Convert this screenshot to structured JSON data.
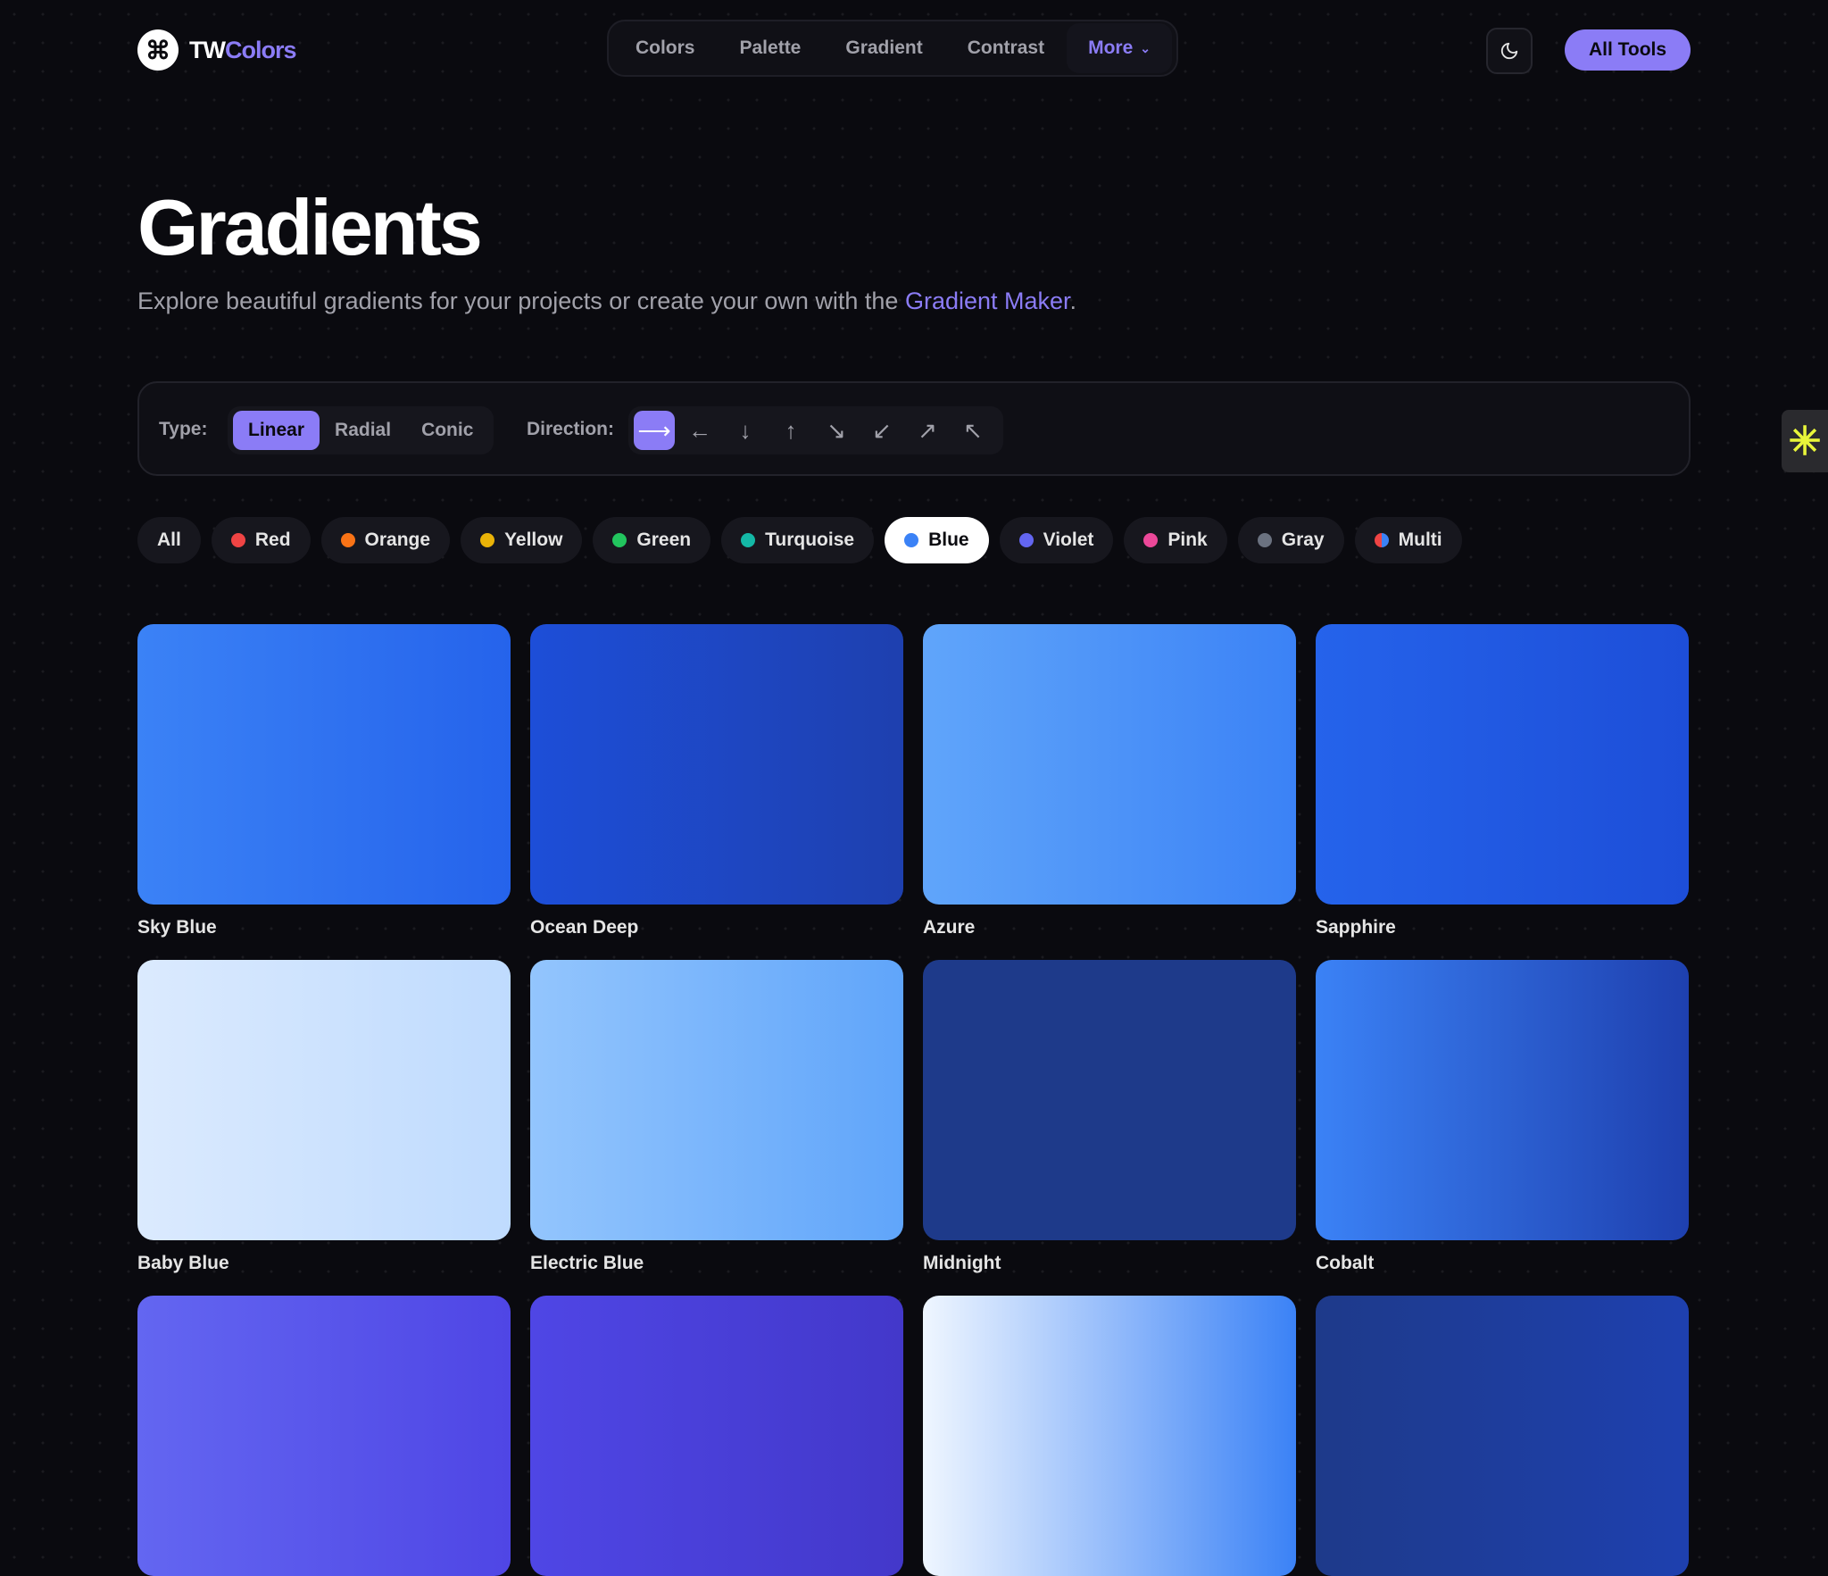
{
  "brand": {
    "logo_glyph": "⌘",
    "name_a": "TW",
    "name_b": "Colors"
  },
  "nav": {
    "items": [
      "Colors",
      "Palette",
      "Gradient",
      "Contrast"
    ],
    "more_label": "More",
    "chevron_glyph": "⌄"
  },
  "header": {
    "all_tools_label": "All Tools",
    "theme_icon": "moon-icon"
  },
  "page": {
    "title": "Gradients",
    "subtitle_before": "Explore beautiful gradients for your projects or create your own with the ",
    "subtitle_link": "Gradient Maker",
    "subtitle_after": "."
  },
  "controls": {
    "type_label": "Type:",
    "types": [
      "Linear",
      "Radial",
      "Conic"
    ],
    "active_type": "Linear",
    "direction_label": "Direction:",
    "directions": [
      {
        "glyph": "⟶",
        "icon": "arrow-right-icon"
      },
      {
        "glyph": "←",
        "icon": "arrow-left-icon"
      },
      {
        "glyph": "↓",
        "icon": "arrow-down-icon"
      },
      {
        "glyph": "↑",
        "icon": "arrow-up-icon"
      },
      {
        "glyph": "↘",
        "icon": "arrow-down-right-icon"
      },
      {
        "glyph": "↙",
        "icon": "arrow-down-left-icon"
      },
      {
        "glyph": "↗",
        "icon": "arrow-up-right-icon"
      },
      {
        "glyph": "↖",
        "icon": "arrow-up-left-icon"
      }
    ],
    "active_direction": 0
  },
  "filters": [
    {
      "label": "All",
      "color": null
    },
    {
      "label": "Red",
      "color": "#ef4444"
    },
    {
      "label": "Orange",
      "color": "#f97316"
    },
    {
      "label": "Yellow",
      "color": "#eab308"
    },
    {
      "label": "Green",
      "color": "#22c55e"
    },
    {
      "label": "Turquoise",
      "color": "#14b8a6"
    },
    {
      "label": "Blue",
      "color": "#3b82f6"
    },
    {
      "label": "Violet",
      "color": "#6366f1"
    },
    {
      "label": "Pink",
      "color": "#ec4899"
    },
    {
      "label": "Gray",
      "color": "#6b7280"
    },
    {
      "label": "Multi",
      "color": "multi"
    }
  ],
  "active_filter": "Blue",
  "gradients": [
    {
      "name": "Sky Blue",
      "from": "#3b82f6",
      "to": "#2563eb"
    },
    {
      "name": "Ocean Deep",
      "from": "#1d4ed8",
      "to": "#1e40af"
    },
    {
      "name": "Azure",
      "from": "#60a5fa",
      "to": "#3b82f6"
    },
    {
      "name": "Sapphire",
      "from": "#2563eb",
      "to": "#1d4ed8"
    },
    {
      "name": "Baby Blue",
      "from": "#dbeafe",
      "to": "#bfdbfe"
    },
    {
      "name": "Electric Blue",
      "from": "#93c5fd",
      "to": "#60a5fa"
    },
    {
      "name": "Midnight",
      "from": "#1e3a8a",
      "to": "#1e3a8a"
    },
    {
      "name": "Cobalt",
      "from": "#3b82f6",
      "to": "#1e40af"
    },
    {
      "name": "",
      "from": "#6366f1",
      "to": "#4f46e5"
    },
    {
      "name": "",
      "from": "#4f46e5",
      "to": "#4338ca"
    },
    {
      "name": "",
      "from": "#eff6ff",
      "to": "#3b82f6"
    },
    {
      "name": "",
      "from": "#1e3a8a",
      "to": "#1e40af"
    }
  ],
  "side_widget": {
    "glyph": "✳",
    "icon": "asterisk-icon"
  },
  "colors": {
    "accent": "#8b7cf6",
    "background": "#0a0a0f"
  }
}
